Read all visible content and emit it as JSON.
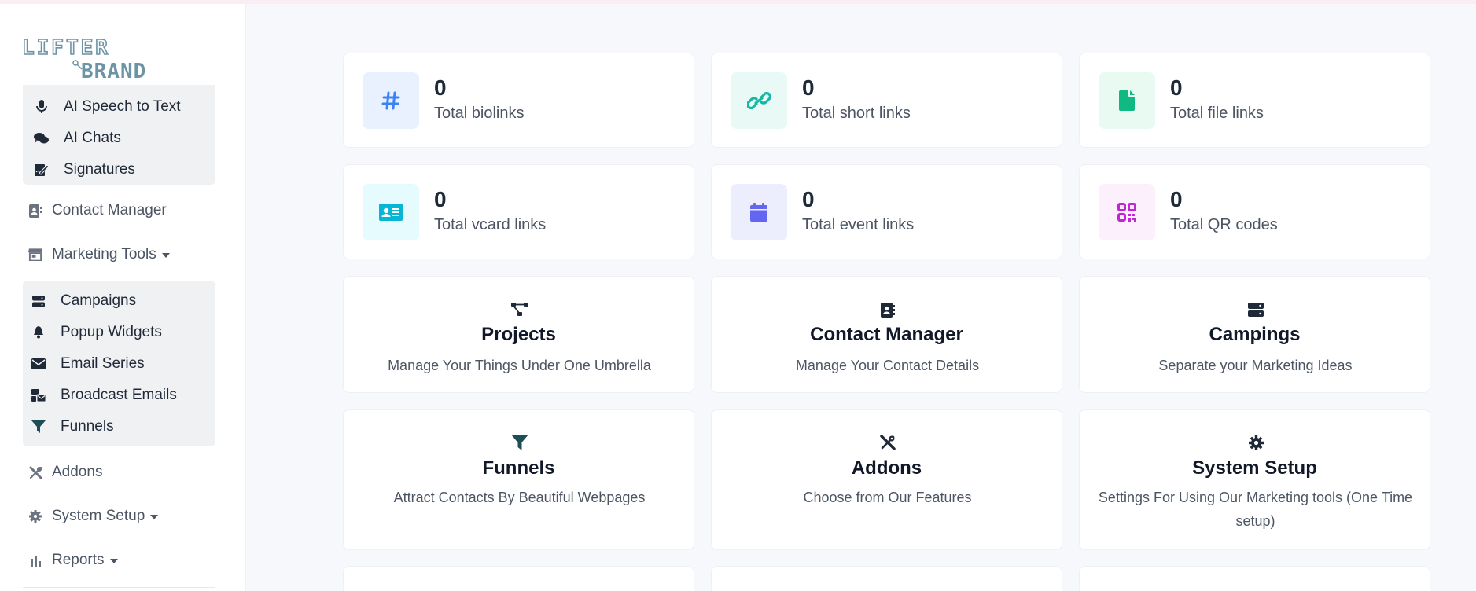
{
  "brand": {
    "line1": "LIFTER",
    "line2": "BRAND"
  },
  "sidebar": {
    "ai_submenu": [
      {
        "label": "AI Speech to Text",
        "icon": "microphone-icon"
      },
      {
        "label": "AI Chats",
        "icon": "comments-icon"
      },
      {
        "label": "Signatures",
        "icon": "signature-icon"
      }
    ],
    "contact_manager": "Contact Manager",
    "marketing_tools": "Marketing Tools",
    "marketing_submenu": [
      {
        "label": "Campaigns",
        "icon": "server-icon"
      },
      {
        "label": "Popup Widgets",
        "icon": "bell-icon"
      },
      {
        "label": "Email Series",
        "icon": "envelope-icon"
      },
      {
        "label": "Broadcast Emails",
        "icon": "mail-bulk-icon"
      },
      {
        "label": "Funnels",
        "icon": "filter-icon"
      }
    ],
    "addons": "Addons",
    "system_setup": "System Setup",
    "reports": "Reports"
  },
  "stats": [
    {
      "value": "0",
      "label": "Total biolinks",
      "icon": "hashtag-icon",
      "badge_bg": "#eaf1fe",
      "icon_color": "#3b82f6"
    },
    {
      "value": "0",
      "label": "Total short links",
      "icon": "link-icon",
      "badge_bg": "#e9faf6",
      "icon_color": "#14b8a6"
    },
    {
      "value": "0",
      "label": "Total file links",
      "icon": "file-icon",
      "badge_bg": "#e8faf1",
      "icon_color": "#10b981"
    },
    {
      "value": "0",
      "label": "Total vcard links",
      "icon": "id-card-icon",
      "badge_bg": "#e5fbfd",
      "icon_color": "#06b6d4"
    },
    {
      "value": "0",
      "label": "Total event links",
      "icon": "calendar-icon",
      "badge_bg": "#eceefe",
      "icon_color": "#6366f1"
    },
    {
      "value": "0",
      "label": "Total QR codes",
      "icon": "qrcode-icon",
      "badge_bg": "#fdf0fd",
      "icon_color": "#c026d3"
    }
  ],
  "features": [
    {
      "title": "Projects",
      "desc": "Manage Your Things Under One Umbrella",
      "icon": "project-diagram-icon"
    },
    {
      "title": "Contact Manager",
      "desc": "Manage Your Contact Details",
      "icon": "address-book-icon"
    },
    {
      "title": "Campings",
      "desc": "Separate your Marketing Ideas",
      "icon": "server-icon"
    },
    {
      "title": "Funnels",
      "desc": "Attract Contacts By Beautiful Webpages",
      "icon": "filter-icon"
    },
    {
      "title": "Addons",
      "desc": "Choose from Our Features",
      "icon": "tools-icon"
    },
    {
      "title": "System Setup",
      "desc": "Settings For Using Our Marketing tools (One Time setup)",
      "icon": "cog-icon"
    }
  ]
}
